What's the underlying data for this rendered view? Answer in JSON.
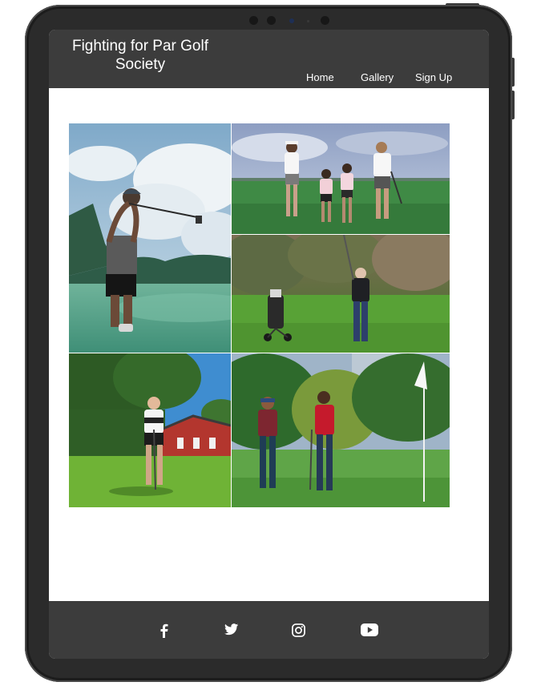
{
  "site": {
    "brand_title": "Fighting for Par Golf Society"
  },
  "nav": {
    "items": [
      {
        "label": "Home"
      },
      {
        "label": "Gallery"
      },
      {
        "label": "Sign Up"
      }
    ]
  },
  "gallery": {
    "photos": [
      {
        "subject": "golfer-follow-through-under-clouds"
      },
      {
        "subject": "family-walking-on-golf-course"
      },
      {
        "subject": "older-golfer-swinging-beside-trolley"
      },
      {
        "subject": "golfer-addressing-ball-near-red-barn"
      },
      {
        "subject": "two-golfers-near-flag-pin"
      }
    ]
  },
  "footer": {
    "social_icons": [
      "facebook-icon",
      "twitter-icon",
      "instagram-icon",
      "youtube-icon"
    ]
  },
  "colors": {
    "header_bg": "#3c3c3c",
    "footer_bg": "#3c3c3c",
    "device_frame": "#2b2b2b",
    "text_light": "#ffffff"
  }
}
